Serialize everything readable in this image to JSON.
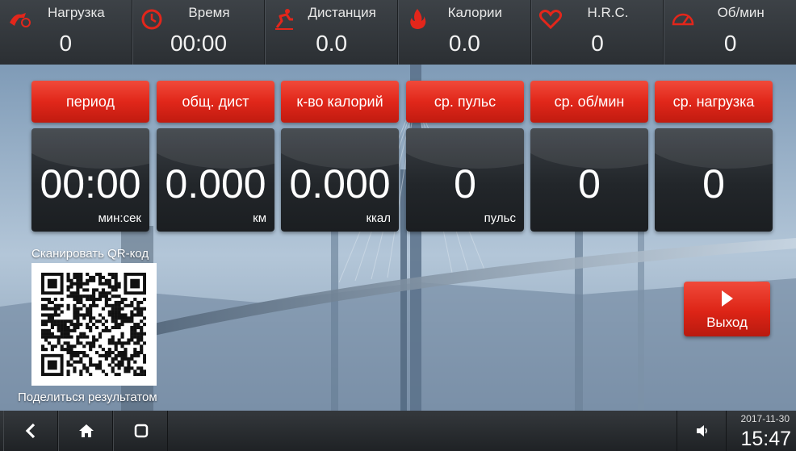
{
  "stats": [
    {
      "icon": "load-icon",
      "label": "Нагрузка",
      "value": "0"
    },
    {
      "icon": "clock-icon",
      "label": "Время",
      "value": "00:00"
    },
    {
      "icon": "runner-icon",
      "label": "Дистанция",
      "value": "0.0"
    },
    {
      "icon": "flame-icon",
      "label": "Калории",
      "value": "0.0"
    },
    {
      "icon": "heart-icon",
      "label": "H.R.C.",
      "value": "0"
    },
    {
      "icon": "speedometer-icon",
      "label": "Об/мин",
      "value": "0"
    }
  ],
  "tiles": [
    {
      "header": "период",
      "value": "00:00",
      "unit": "мин:сек"
    },
    {
      "header": "общ. дист",
      "value": "0.000",
      "unit": "км"
    },
    {
      "header": "к-во калорий",
      "value": "0.000",
      "unit": "ккал"
    },
    {
      "header": "ср. пульс",
      "value": "0",
      "unit": "пульс"
    },
    {
      "header": "ср. об/мин",
      "value": "0",
      "unit": ""
    },
    {
      "header": "ср. нагрузка",
      "value": "0",
      "unit": ""
    }
  ],
  "qr": {
    "title": "Сканировать QR-код",
    "share": "Поделиться результатом"
  },
  "exit": {
    "label": "Выход"
  },
  "nav": {
    "back_icon": "back-icon",
    "home_icon": "home-icon",
    "recents_icon": "recents-icon",
    "volume_icon": "volume-icon"
  },
  "status": {
    "date": "2017-11-30",
    "time": "15:47"
  },
  "colors": {
    "accent_red": "#e1271a",
    "tile_dark": "#22262a",
    "bar_dark": "#2b2f33"
  }
}
